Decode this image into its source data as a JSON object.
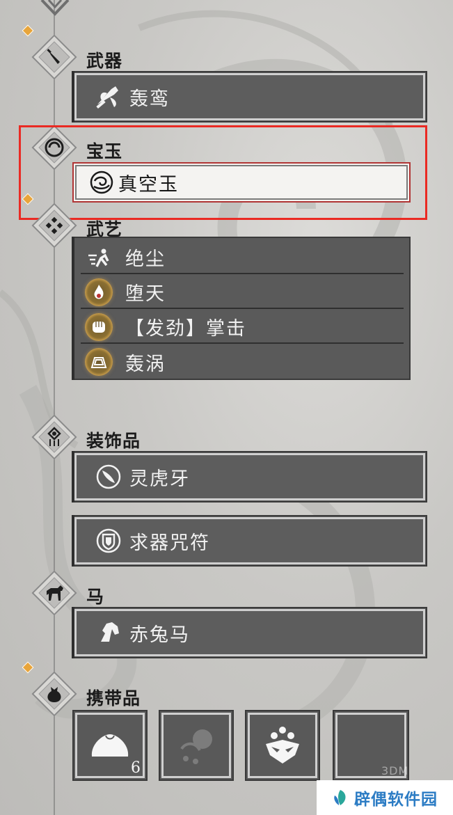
{
  "sections": {
    "weapon": {
      "title": "武器",
      "item": "轰鸾",
      "icon": "axe-icon"
    },
    "gem": {
      "title": "宝玉",
      "item": "真空玉",
      "icon": "swirl-orb-icon"
    },
    "arts": {
      "title": "武艺",
      "items": [
        {
          "label": "绝尘",
          "icon": "dash-icon"
        },
        {
          "label": "堕天",
          "icon": "flame-icon"
        },
        {
          "label": "【发劲】掌击",
          "icon": "fist-icon"
        },
        {
          "label": "轰涡",
          "icon": "vortex-icon"
        }
      ]
    },
    "accessory": {
      "title": "装饰品",
      "items": [
        {
          "label": "灵虎牙",
          "icon": "fang-icon"
        },
        {
          "label": "求器咒符",
          "icon": "talisman-icon"
        }
      ]
    },
    "horse": {
      "title": "马",
      "item": "赤兔马",
      "icon": "horse-head-icon"
    },
    "carry": {
      "title": "携带品",
      "slots": [
        {
          "icon": "bun-icon",
          "count": "6"
        },
        {
          "icon": "pouch-icon",
          "count": ""
        },
        {
          "icon": "mask-icon",
          "count": ""
        },
        {
          "icon": "empty-slot",
          "count": ""
        }
      ]
    }
  },
  "watermark": {
    "text": "辟偶软件园",
    "faint": "3DM"
  },
  "colors": {
    "highlight": "#ea2a23",
    "badge": "#e8a53b",
    "panel": "#5d5d5d"
  }
}
